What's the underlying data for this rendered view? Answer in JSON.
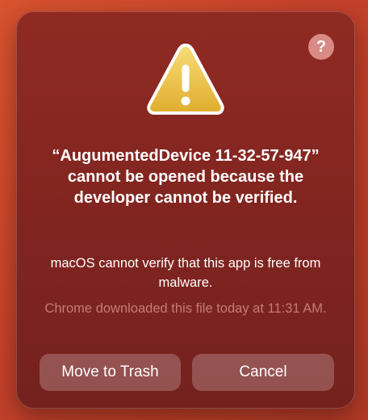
{
  "dialog": {
    "help_label": "?",
    "title": "“AugumentedDevice 11-32-57-947” cannot be opened because the developer cannot be verified.",
    "message": "macOS cannot verify that this app is free from malware.",
    "source_note": "Chrome downloaded this file today at 11:31 AM.",
    "icon": "warning-triangle-icon",
    "buttons": {
      "move_to_trash": "Move to Trash",
      "cancel": "Cancel"
    }
  },
  "colors": {
    "dialog_bg": "#832620",
    "warning_yellow": "#f2c94c",
    "button_bg": "#b05a54",
    "muted_text": "#c47b73"
  }
}
